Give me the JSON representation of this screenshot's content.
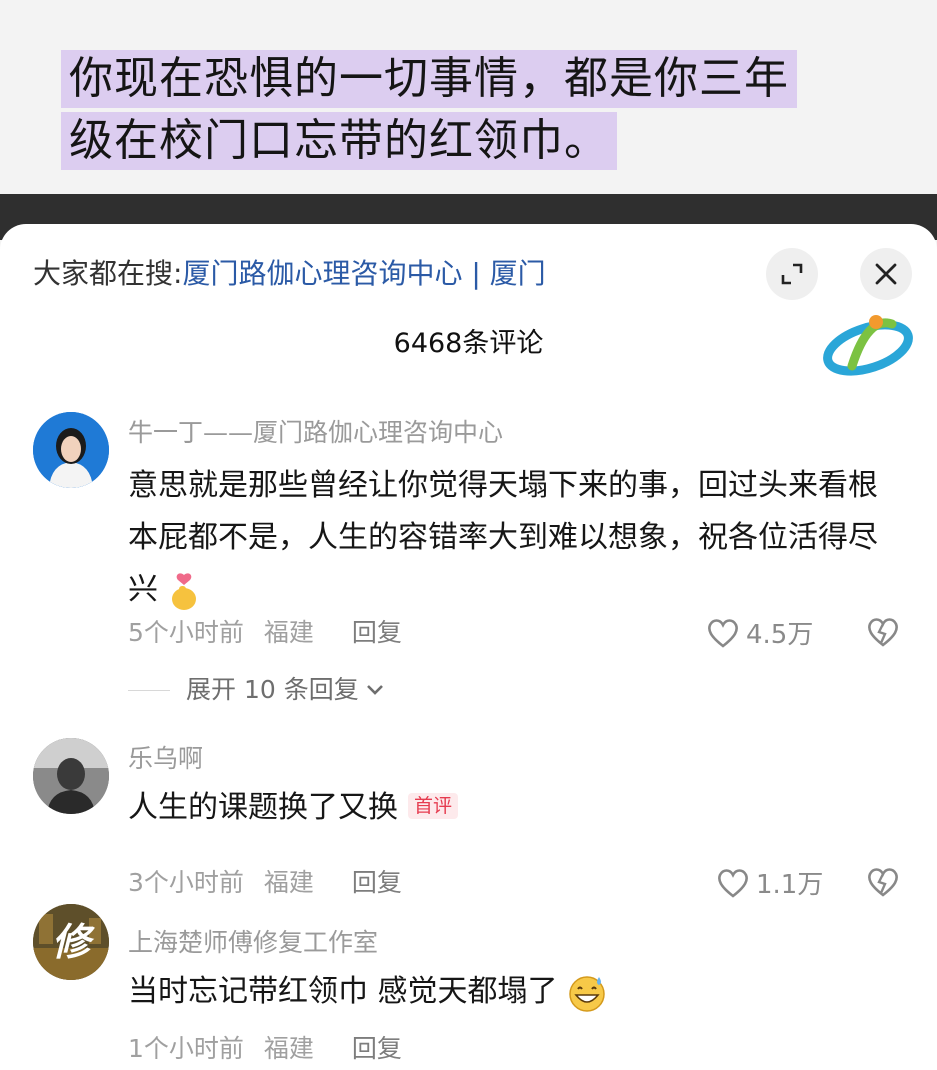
{
  "caption": {
    "line1": "你现在恐惧的一切事情，都是你三年",
    "line2": "级在校门口忘带的红领巾。"
  },
  "sheet": {
    "search_prefix": "大家都在搜:",
    "search_link": "厦门路伽心理咨询中心 | 厦门",
    "comment_count": "6468条评论",
    "expand_icon": "expand-icon",
    "close_icon": "close-icon"
  },
  "comments": [
    {
      "author": "牛一丁——厦门路伽心理咨询中心",
      "text": "意思就是那些曾经让你觉得天塌下来的事，回过头来看根本屁都不是，人生的容错率大到难以想象，祝各位活得尽兴",
      "emoji": "finger-heart-emoji",
      "time": "5个小时前",
      "location": "福建",
      "reply": "回复",
      "likes": "4.5万",
      "expand_replies": "展开 10 条回复",
      "avatar_color": "#1f7ad6"
    },
    {
      "author": "乐乌啊",
      "text": "人生的课题换了又换",
      "badge": "首评",
      "time": "3个小时前",
      "location": "福建",
      "reply": "回复",
      "likes": "1.1万"
    },
    {
      "author": "上海楚师傅修复工作室",
      "text": "当时忘记带红领巾 感觉天都塌了",
      "emoji": "grinning-sweat-emoji",
      "avatar_char": "修",
      "time": "1个小时前",
      "location": "福建",
      "reply": "回复"
    }
  ],
  "colors": {
    "caption_highlight": "#dccdf0",
    "link_blue": "#2b5aa6",
    "badge_red": "#e63b4f"
  }
}
